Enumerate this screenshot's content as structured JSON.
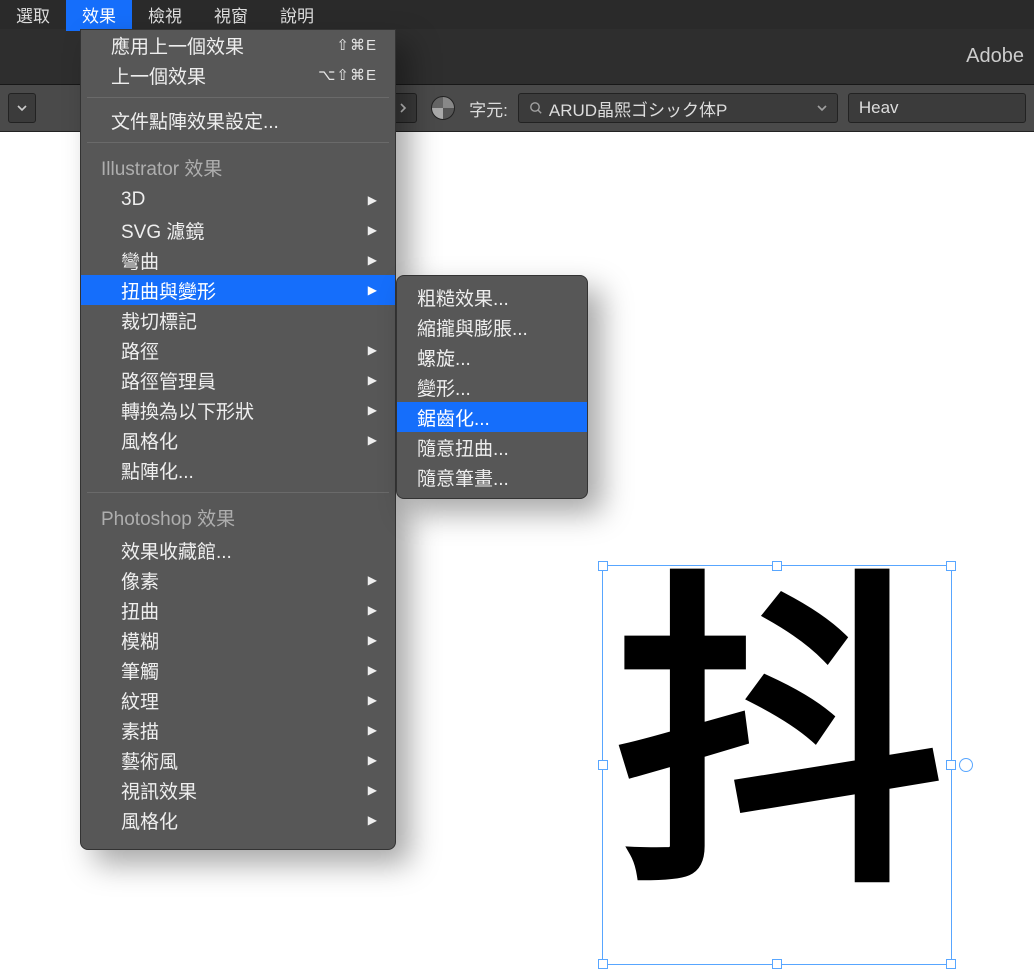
{
  "menubar": {
    "items": [
      "選取",
      "效果",
      "檢視",
      "視窗",
      "說明"
    ],
    "activeIndex": 1
  },
  "header": {
    "brand_partial": "Adobe"
  },
  "toolbar": {
    "percent_suffix": "%",
    "char_label": "字元:",
    "font_name": "ARUD晶熙ゴシック体P",
    "weight_partial": "Heav"
  },
  "menu": {
    "apply_last": {
      "label": "應用上一個效果",
      "shortcut": "⇧⌘E"
    },
    "prev_effect": {
      "label": "上一個效果",
      "shortcut": "⌥⇧⌘E"
    },
    "doc_raster": "文件點陣效果設定...",
    "illustrator_section": "Illustrator 效果",
    "ai_items": [
      {
        "label": "3D",
        "arrow": true
      },
      {
        "label": "SVG 濾鏡",
        "arrow": true
      },
      {
        "label": "彎曲",
        "arrow": true
      },
      {
        "label": "扭曲與變形",
        "arrow": true,
        "hover": true
      },
      {
        "label": "裁切標記",
        "arrow": false
      },
      {
        "label": "路徑",
        "arrow": true
      },
      {
        "label": "路徑管理員",
        "arrow": true
      },
      {
        "label": "轉換為以下形狀",
        "arrow": true
      },
      {
        "label": "風格化",
        "arrow": true
      },
      {
        "label": "點陣化...",
        "arrow": false
      }
    ],
    "photoshop_section": "Photoshop 效果",
    "ps_items": [
      {
        "label": "效果收藏館...",
        "arrow": false
      },
      {
        "label": "像素",
        "arrow": true
      },
      {
        "label": "扭曲",
        "arrow": true
      },
      {
        "label": "模糊",
        "arrow": true
      },
      {
        "label": "筆觸",
        "arrow": true
      },
      {
        "label": "紋理",
        "arrow": true
      },
      {
        "label": "素描",
        "arrow": true
      },
      {
        "label": "藝術風",
        "arrow": true
      },
      {
        "label": "視訊效果",
        "arrow": true
      },
      {
        "label": "風格化",
        "arrow": true
      }
    ]
  },
  "submenu": {
    "items": [
      {
        "label": "粗糙效果...",
        "hover": false
      },
      {
        "label": "縮攏與膨脹...",
        "hover": false
      },
      {
        "label": "螺旋...",
        "hover": false
      },
      {
        "label": "變形...",
        "hover": false
      },
      {
        "label": "鋸齒化...",
        "hover": true
      },
      {
        "label": "隨意扭曲...",
        "hover": false
      },
      {
        "label": "隨意筆畫...",
        "hover": false
      }
    ]
  },
  "canvas": {
    "glyph": "抖"
  }
}
